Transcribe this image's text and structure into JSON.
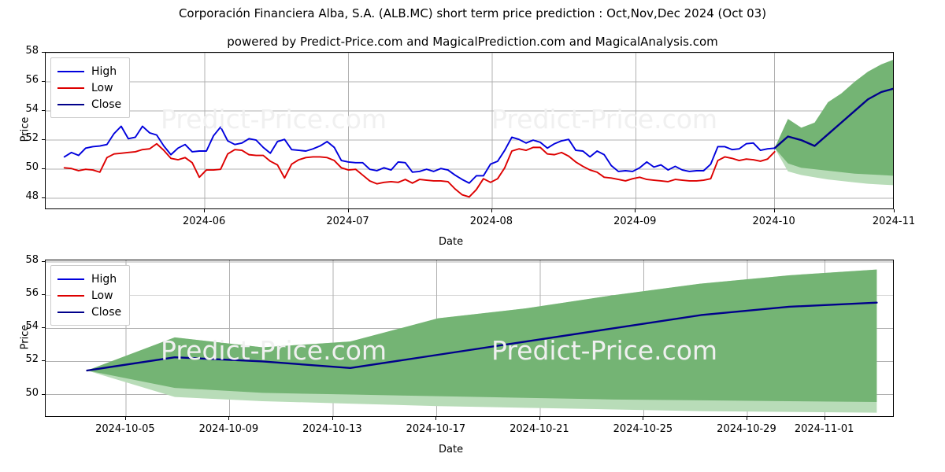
{
  "title": {
    "main": "Corporación Financiera Alba, S.A. (ALB.MC) short term price prediction : Oct,Nov,Dec 2024 (Oct 03)",
    "sub": "powered by Predict-Price.com and MagicalPrediction.com and MagicalAnalysis.com"
  },
  "watermark_text": "Predict-Price.com",
  "colors": {
    "high": "#0000dd",
    "low": "#dd0000",
    "close": "#00008b",
    "band_inner": "#74b474",
    "band_outer": "#b8dcb8",
    "grid": "#b0b0b0",
    "frame": "#000000",
    "watermark": "#f0f0f0"
  },
  "legend": {
    "items": [
      {
        "label": "High",
        "color": "#0000dd"
      },
      {
        "label": "Low",
        "color": "#dd0000"
      },
      {
        "label": "Close",
        "color": "#00008b"
      }
    ]
  },
  "chart_data": [
    {
      "id": "overview",
      "type": "line",
      "title": "",
      "xlabel": "Date",
      "ylabel": "Price",
      "ylim": [
        47.2,
        58.0
      ],
      "yticks": [
        48,
        50,
        52,
        54,
        56,
        58
      ],
      "xlim": [
        "2024-05-17",
        "2024-11-08"
      ],
      "xticks": [
        "2024-06",
        "2024-07",
        "2024-08",
        "2024-09",
        "2024-10",
        "2024-11"
      ],
      "xtick_positions": [
        0.1875,
        0.3567,
        0.5259,
        0.6951,
        0.8587,
        1.0
      ],
      "grid": true,
      "legend_position": "upper left",
      "series": [
        {
          "name": "High",
          "color": "#0000dd",
          "values": [
            50.85,
            51.15,
            50.95,
            51.45,
            51.55,
            51.6,
            51.7,
            52.45,
            52.95,
            52.1,
            52.2,
            52.95,
            52.5,
            52.35,
            51.6,
            51.0,
            51.45,
            51.7,
            51.2,
            51.25,
            51.25,
            52.3,
            52.9,
            51.95,
            51.7,
            51.8,
            52.1,
            52.0,
            51.5,
            51.1,
            51.9,
            52.05,
            51.35,
            51.3,
            51.25,
            51.4,
            51.6,
            51.9,
            51.5,
            50.6,
            50.5,
            50.45,
            50.45,
            50.0,
            49.9,
            50.1,
            49.95,
            50.5,
            50.45,
            49.8,
            49.85,
            50.0,
            49.85,
            50.05,
            49.95,
            49.6,
            49.3,
            49.05,
            49.55,
            49.55,
            50.35,
            50.55,
            51.3,
            52.2,
            52.05,
            51.8,
            52.0,
            51.85,
            51.45,
            51.75,
            51.95,
            52.05,
            51.3,
            51.25,
            50.85,
            51.25,
            51.0,
            50.25,
            49.85,
            49.9,
            49.85,
            50.1,
            50.5,
            50.15,
            50.3,
            49.95,
            50.2,
            49.95,
            49.85,
            49.9,
            49.9,
            50.35,
            51.55,
            51.55,
            51.35,
            51.4,
            51.75,
            51.8,
            51.3,
            51.4,
            51.45
          ]
        },
        {
          "name": "Low",
          "color": "#dd0000",
          "values": [
            50.1,
            50.05,
            49.9,
            50.0,
            49.95,
            49.8,
            50.8,
            51.05,
            51.1,
            51.15,
            51.2,
            51.35,
            51.4,
            51.75,
            51.3,
            50.75,
            50.65,
            50.8,
            50.45,
            49.45,
            49.95,
            49.95,
            50.0,
            51.05,
            51.35,
            51.3,
            51.0,
            50.95,
            50.95,
            50.55,
            50.3,
            49.4,
            50.35,
            50.65,
            50.8,
            50.85,
            50.85,
            50.8,
            50.6,
            50.1,
            49.95,
            50.0,
            49.6,
            49.2,
            49.0,
            49.1,
            49.15,
            49.1,
            49.3,
            49.05,
            49.3,
            49.25,
            49.2,
            49.2,
            49.15,
            48.65,
            48.25,
            48.1,
            48.6,
            49.35,
            49.1,
            49.35,
            50.1,
            51.25,
            51.4,
            51.3,
            51.5,
            51.5,
            51.05,
            51.0,
            51.15,
            50.9,
            50.5,
            50.2,
            49.95,
            49.8,
            49.45,
            49.4,
            49.3,
            49.2,
            49.35,
            49.45,
            49.3,
            49.25,
            49.2,
            49.15,
            49.3,
            49.25,
            49.2,
            49.2,
            49.25,
            49.35,
            50.6,
            50.85,
            50.75,
            50.6,
            50.7,
            50.65,
            50.55,
            50.7,
            51.2
          ]
        }
      ],
      "prediction": {
        "name": "Close",
        "color": "#00008b",
        "x_start_fraction": 0.8587,
        "x_end_fraction": 1.0,
        "values": [
          51.45,
          52.25,
          52.0,
          51.6,
          52.4,
          53.2,
          54.0,
          54.8,
          55.3,
          55.55
        ],
        "band_inner_upper": [
          51.45,
          53.45,
          52.85,
          53.2,
          54.6,
          55.2,
          56.0,
          56.7,
          57.2,
          57.55
        ],
        "band_inner_lower": [
          51.45,
          50.4,
          50.1,
          50.0,
          49.9,
          49.8,
          49.7,
          49.65,
          49.6,
          49.55
        ],
        "band_outer_upper": [
          51.45,
          53.45,
          52.85,
          53.2,
          54.6,
          55.2,
          56.0,
          56.7,
          57.2,
          57.55
        ],
        "band_outer_lower": [
          51.45,
          49.85,
          49.6,
          49.45,
          49.3,
          49.2,
          49.1,
          49.0,
          48.95,
          48.9
        ]
      }
    },
    {
      "id": "detail",
      "type": "line",
      "title": "",
      "xlabel": "Date",
      "ylabel": "Price",
      "ylim": [
        48.6,
        58.1
      ],
      "yticks": [
        50,
        52,
        54,
        56,
        58
      ],
      "xlim": [
        "2024-10-02",
        "2024-11-03"
      ],
      "xticks": [
        "2024-10-05",
        "2024-10-09",
        "2024-10-13",
        "2024-10-17",
        "2024-10-21",
        "2024-10-25",
        "2024-10-29",
        "2024-11-01"
      ],
      "xtick_positions": [
        0.0945,
        0.2165,
        0.3385,
        0.4605,
        0.5825,
        0.7045,
        0.8265,
        0.918
      ],
      "grid": true,
      "legend_position": "upper left",
      "prediction": {
        "name": "Close",
        "color": "#00008b",
        "x_start_fraction": 0.0487,
        "x_end_fraction": 0.979,
        "values": [
          51.45,
          52.25,
          52.0,
          51.6,
          52.4,
          53.2,
          54.0,
          54.8,
          55.3,
          55.55
        ],
        "band_inner_upper": [
          51.45,
          53.45,
          52.85,
          53.2,
          54.6,
          55.2,
          56.0,
          56.7,
          57.2,
          57.55
        ],
        "band_inner_lower": [
          51.45,
          50.4,
          50.1,
          50.0,
          49.9,
          49.8,
          49.7,
          49.65,
          49.6,
          49.55
        ],
        "band_outer_upper": [
          51.45,
          53.45,
          52.85,
          53.2,
          54.6,
          55.2,
          56.0,
          56.7,
          57.2,
          57.55
        ],
        "band_outer_lower": [
          51.45,
          49.85,
          49.6,
          49.45,
          49.3,
          49.2,
          49.1,
          49.0,
          48.95,
          48.9
        ]
      }
    }
  ]
}
